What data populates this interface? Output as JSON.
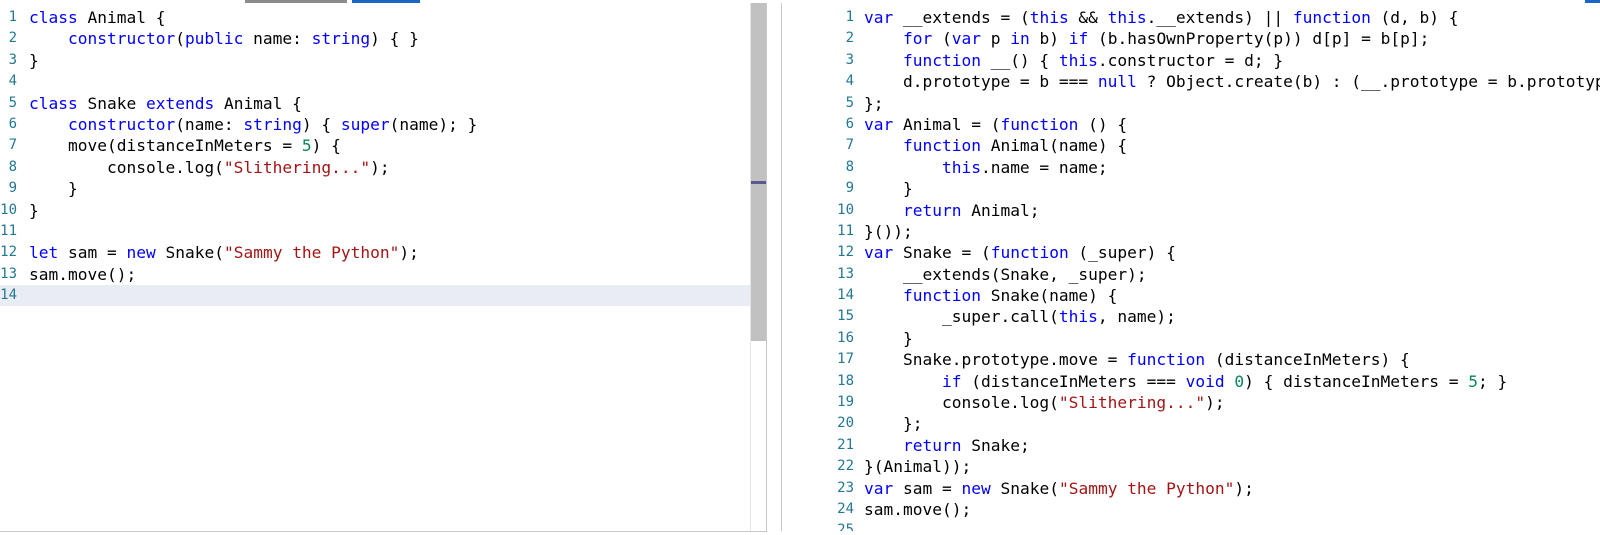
{
  "left_editor": {
    "language": "typescript",
    "lines": [
      {
        "n": "1",
        "tokens": [
          {
            "t": "class",
            "c": "kw"
          },
          {
            "t": " Animal {"
          }
        ]
      },
      {
        "n": "2",
        "tokens": [
          {
            "t": "    "
          },
          {
            "t": "constructor",
            "c": "kw"
          },
          {
            "t": "("
          },
          {
            "t": "public",
            "c": "kw"
          },
          {
            "t": " name: "
          },
          {
            "t": "string",
            "c": "kw"
          },
          {
            "t": ") { }"
          }
        ]
      },
      {
        "n": "3",
        "tokens": [
          {
            "t": "}"
          }
        ]
      },
      {
        "n": "4",
        "tokens": []
      },
      {
        "n": "5",
        "tokens": [
          {
            "t": "class",
            "c": "kw"
          },
          {
            "t": " Snake "
          },
          {
            "t": "extends",
            "c": "kw"
          },
          {
            "t": " Animal {"
          }
        ]
      },
      {
        "n": "6",
        "tokens": [
          {
            "t": "    "
          },
          {
            "t": "constructor",
            "c": "kw"
          },
          {
            "t": "(name: "
          },
          {
            "t": "string",
            "c": "kw"
          },
          {
            "t": ") { "
          },
          {
            "t": "super",
            "c": "kw"
          },
          {
            "t": "(name); }"
          }
        ]
      },
      {
        "n": "7",
        "tokens": [
          {
            "t": "    move(distanceInMeters = "
          },
          {
            "t": "5",
            "c": "num"
          },
          {
            "t": ") {"
          }
        ]
      },
      {
        "n": "8",
        "tokens": [
          {
            "t": "        console.log("
          },
          {
            "t": "\"Slithering...\"",
            "c": "str"
          },
          {
            "t": ");"
          }
        ]
      },
      {
        "n": "9",
        "tokens": [
          {
            "t": "    }"
          }
        ]
      },
      {
        "n": "10",
        "tokens": [
          {
            "t": "}"
          }
        ]
      },
      {
        "n": "11",
        "tokens": []
      },
      {
        "n": "12",
        "tokens": [
          {
            "t": "let",
            "c": "kw"
          },
          {
            "t": " sam = "
          },
          {
            "t": "new",
            "c": "kw"
          },
          {
            "t": " Snake("
          },
          {
            "t": "\"Sammy the Python\"",
            "c": "str"
          },
          {
            "t": ");"
          }
        ]
      },
      {
        "n": "13",
        "tokens": [
          {
            "t": "sam.move();"
          }
        ]
      },
      {
        "n": "14",
        "tokens": [],
        "current": true
      }
    ]
  },
  "right_editor": {
    "language": "javascript",
    "lines": [
      {
        "n": "1",
        "tokens": [
          {
            "t": "var",
            "c": "kw"
          },
          {
            "t": " __extends = ("
          },
          {
            "t": "this",
            "c": "kw"
          },
          {
            "t": " && "
          },
          {
            "t": "this",
            "c": "kw"
          },
          {
            "t": ".__extends) || "
          },
          {
            "t": "function",
            "c": "kw"
          },
          {
            "t": " (d, b) {"
          }
        ]
      },
      {
        "n": "2",
        "tokens": [
          {
            "t": "    "
          },
          {
            "t": "for",
            "c": "kw"
          },
          {
            "t": " ("
          },
          {
            "t": "var",
            "c": "kw"
          },
          {
            "t": " p "
          },
          {
            "t": "in",
            "c": "kw"
          },
          {
            "t": " b) "
          },
          {
            "t": "if",
            "c": "kw"
          },
          {
            "t": " (b.hasOwnProperty(p)) d[p] = b[p];"
          }
        ]
      },
      {
        "n": "3",
        "tokens": [
          {
            "t": "    "
          },
          {
            "t": "function",
            "c": "kw"
          },
          {
            "t": " __() { "
          },
          {
            "t": "this",
            "c": "kw"
          },
          {
            "t": ".constructor = d; }"
          }
        ]
      },
      {
        "n": "4",
        "tokens": [
          {
            "t": "    d.prototype = b === "
          },
          {
            "t": "null",
            "c": "kw"
          },
          {
            "t": " ? Object.create(b) : (__.prototype = b.prototype, new __());"
          }
        ]
      },
      {
        "n": "5",
        "tokens": [
          {
            "t": "};"
          }
        ]
      },
      {
        "n": "6",
        "tokens": [
          {
            "t": "var",
            "c": "kw"
          },
          {
            "t": " Animal = ("
          },
          {
            "t": "function",
            "c": "kw"
          },
          {
            "t": " () {"
          }
        ]
      },
      {
        "n": "7",
        "tokens": [
          {
            "t": "    "
          },
          {
            "t": "function",
            "c": "kw"
          },
          {
            "t": " Animal(name) {"
          }
        ]
      },
      {
        "n": "8",
        "tokens": [
          {
            "t": "        "
          },
          {
            "t": "this",
            "c": "kw"
          },
          {
            "t": ".name = name;"
          }
        ]
      },
      {
        "n": "9",
        "tokens": [
          {
            "t": "    }"
          }
        ]
      },
      {
        "n": "10",
        "tokens": [
          {
            "t": "    "
          },
          {
            "t": "return",
            "c": "kw"
          },
          {
            "t": " Animal;"
          }
        ]
      },
      {
        "n": "11",
        "tokens": [
          {
            "t": "}());"
          }
        ]
      },
      {
        "n": "12",
        "tokens": [
          {
            "t": "var",
            "c": "kw"
          },
          {
            "t": " Snake = ("
          },
          {
            "t": "function",
            "c": "kw"
          },
          {
            "t": " (_super) {"
          }
        ]
      },
      {
        "n": "13",
        "tokens": [
          {
            "t": "    __extends(Snake, _super);"
          }
        ]
      },
      {
        "n": "14",
        "tokens": [
          {
            "t": "    "
          },
          {
            "t": "function",
            "c": "kw"
          },
          {
            "t": " Snake(name) {"
          }
        ]
      },
      {
        "n": "15",
        "tokens": [
          {
            "t": "        _super.call("
          },
          {
            "t": "this",
            "c": "kw"
          },
          {
            "t": ", name);"
          }
        ]
      },
      {
        "n": "16",
        "tokens": [
          {
            "t": "    }"
          }
        ]
      },
      {
        "n": "17",
        "tokens": [
          {
            "t": "    Snake.prototype.move = "
          },
          {
            "t": "function",
            "c": "kw"
          },
          {
            "t": " (distanceInMeters) {"
          }
        ]
      },
      {
        "n": "18",
        "tokens": [
          {
            "t": "        "
          },
          {
            "t": "if",
            "c": "kw"
          },
          {
            "t": " (distanceInMeters === "
          },
          {
            "t": "void",
            "c": "kw"
          },
          {
            "t": " "
          },
          {
            "t": "0",
            "c": "num"
          },
          {
            "t": ") { distanceInMeters = "
          },
          {
            "t": "5",
            "c": "num"
          },
          {
            "t": "; }"
          }
        ]
      },
      {
        "n": "19",
        "tokens": [
          {
            "t": "        console.log("
          },
          {
            "t": "\"Slithering...\"",
            "c": "str"
          },
          {
            "t": ");"
          }
        ]
      },
      {
        "n": "20",
        "tokens": [
          {
            "t": "    };"
          }
        ]
      },
      {
        "n": "21",
        "tokens": [
          {
            "t": "    "
          },
          {
            "t": "return",
            "c": "kw"
          },
          {
            "t": " Snake;"
          }
        ]
      },
      {
        "n": "22",
        "tokens": [
          {
            "t": "}(Animal));"
          }
        ]
      },
      {
        "n": "23",
        "tokens": [
          {
            "t": "var",
            "c": "kw"
          },
          {
            "t": " sam = "
          },
          {
            "t": "new",
            "c": "kw"
          },
          {
            "t": " Snake("
          },
          {
            "t": "\"Sammy the Python\"",
            "c": "str"
          },
          {
            "t": ");"
          }
        ]
      },
      {
        "n": "24",
        "tokens": [
          {
            "t": "sam.move();"
          }
        ]
      },
      {
        "n": "25",
        "tokens": []
      }
    ]
  }
}
